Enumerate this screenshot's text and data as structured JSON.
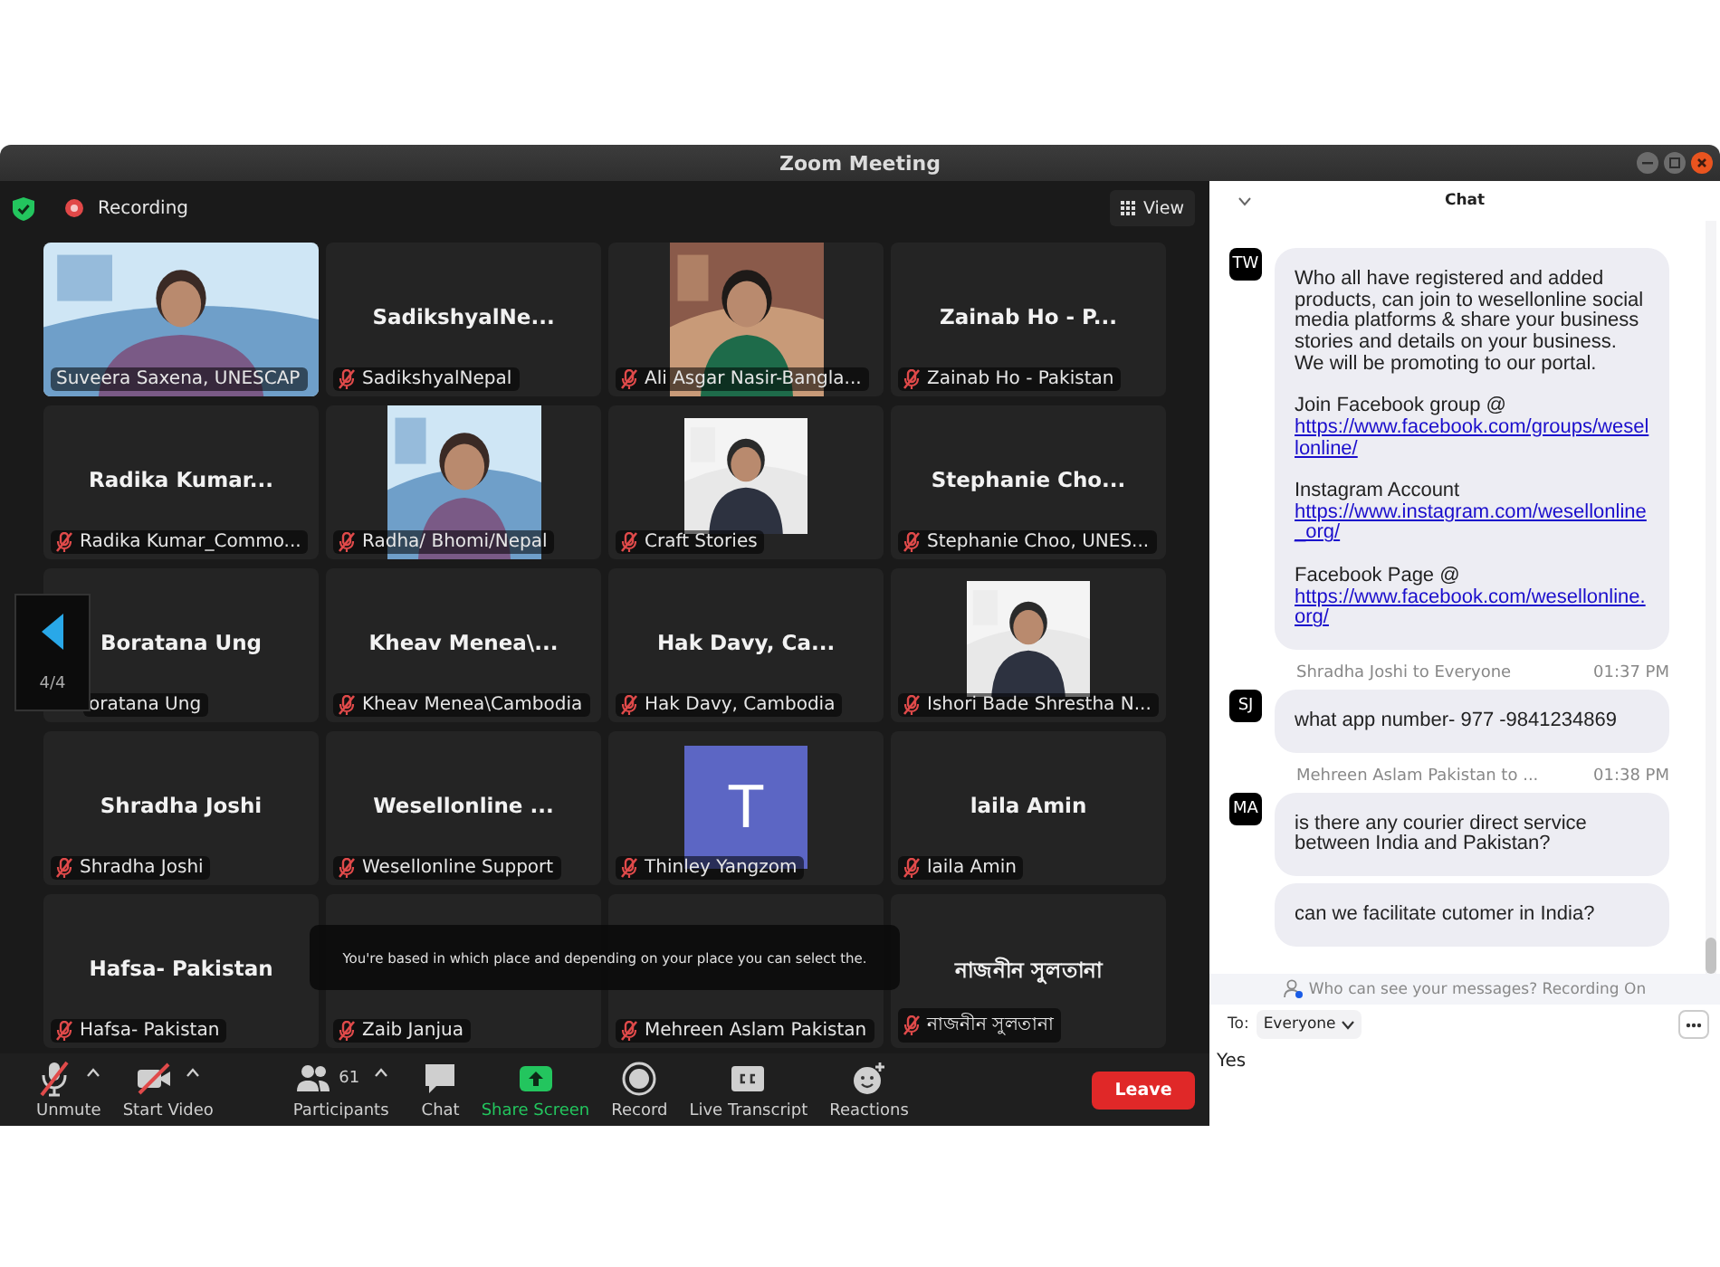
{
  "window": {
    "title": "Zoom Meeting"
  },
  "meeting": {
    "recording_label": "Recording",
    "view_button": "View",
    "page_indicator": "4/4",
    "tiles": [
      {
        "kind": "video",
        "label": "Suveera Saxena, UNESCAP",
        "muted": false
      },
      {
        "kind": "name",
        "name": "SadikshyalNe...",
        "label": "SadikshyalNepal",
        "muted": true
      },
      {
        "label": "Ali Asgar Nasir-Bangla...",
        "muted": true
      },
      {
        "kind": "name",
        "name": "Zainab Ho - P...",
        "label": "Zainab Ho - Pakistan",
        "muted": true
      },
      {
        "kind": "name",
        "name": "Radika Kumar...",
        "label": "Radika Kumar_Commo...",
        "muted": true
      },
      {
        "label": "Radha/ Bhomi/Nepal",
        "muted": true
      },
      {
        "kind": "photo_inset",
        "label": "Craft Stories",
        "muted": true
      },
      {
        "kind": "name",
        "name": "Stephanie Cho...",
        "label": "Stephanie Choo, UNES...",
        "muted": true
      },
      {
        "kind": "name",
        "name": "Boratana Ung",
        "label": "oratana Ung",
        "muted": false
      },
      {
        "kind": "name",
        "name": "Kheav Menea\\...",
        "label": "Kheav Menea\\Cambodia",
        "muted": true
      },
      {
        "kind": "name",
        "name": "Hak Davy, Ca...",
        "label": "Hak Davy, Cambodia",
        "muted": true
      },
      {
        "kind": "photo_inset",
        "label": "Ishori Bade Shrestha N...",
        "muted": true
      },
      {
        "kind": "name",
        "name": "Shradha Joshi",
        "label": "Shradha Joshi",
        "muted": true
      },
      {
        "kind": "name",
        "name": "Wesellonline ...",
        "label": "Wesellonline Support",
        "muted": true
      },
      {
        "kind": "avatar",
        "letter": "T",
        "label": "Thinley Yangzom",
        "muted": true
      },
      {
        "kind": "name",
        "name": "laila Amin",
        "label": "laila Amin",
        "muted": true
      },
      {
        "kind": "name",
        "name": "Hafsa- Pakistan",
        "label": "Hafsa- Pakistan",
        "muted": true
      },
      {
        "kind": "name",
        "label": "Zaib Janjua",
        "muted": true
      },
      {
        "kind": "name",
        "label": "Mehreen Aslam Pakistan",
        "muted": true
      },
      {
        "kind": "name",
        "name": "নাজনীন সুলতানা",
        "label": "নাজনীন সুলতানা",
        "muted": true
      }
    ],
    "caption": "You're based in which place and depending on your place you can select the.",
    "toolbar": [
      {
        "kind": "mic_muted",
        "label": "Unmute",
        "caret": true
      },
      {
        "kind": "video_off",
        "label": "Start Video",
        "caret": true
      },
      {
        "kind": "participants",
        "label": "Participants",
        "count": "61",
        "caret": true
      },
      {
        "kind": "chat",
        "label": "Chat",
        "caret": false
      },
      {
        "kind": "share",
        "label": "Share Screen",
        "caret": false
      },
      {
        "kind": "record",
        "label": "Record",
        "caret": false
      },
      {
        "kind": "transcript",
        "label": "Live Transcript",
        "caret": false
      },
      {
        "kind": "reactions",
        "label": "Reactions",
        "caret": false
      }
    ],
    "leave_button": "Leave"
  },
  "chat": {
    "title": "Chat",
    "messages": [
      {
        "avatar": "TW",
        "bubbles": [
          {
            "paragraphs": [
              {
                "text": "Who all have registered and added products, can join to wesellonline social media platforms & share your business stories and details on your business. We will be promoting to our portal."
              },
              {
                "text": "Join Facebook group @",
                "link": "https://www.facebook.com/groups/wesellonline/"
              },
              {
                "text": "Instagram Account",
                "link": "https://www.instagram.com/wesellonline_org/"
              },
              {
                "text": "Facebook Page @",
                "link": "https://www.facebook.com/wesellonline.org/"
              }
            ]
          }
        ]
      },
      {
        "sender": "Shradha Joshi to Everyone",
        "time": "01:37 PM",
        "avatar": "SJ",
        "bubbles": [
          {
            "paragraphs": [
              {
                "text": "what app number- 977 -9841234869"
              }
            ]
          }
        ]
      },
      {
        "sender": "Mehreen Aslam Pakistan to ...",
        "time": "01:38 PM",
        "avatar": "MA",
        "bubbles": [
          {
            "paragraphs": [
              {
                "text": "is there any courier direct service between India and Pakistan?"
              }
            ]
          },
          {
            "paragraphs": [
              {
                "text": "can we facilitate cutomer in India?"
              }
            ]
          }
        ]
      }
    ],
    "notice": "Who can see your messages? Recording On",
    "to_label": "To:",
    "recipient": "Everyone",
    "input_value": "Yes"
  }
}
